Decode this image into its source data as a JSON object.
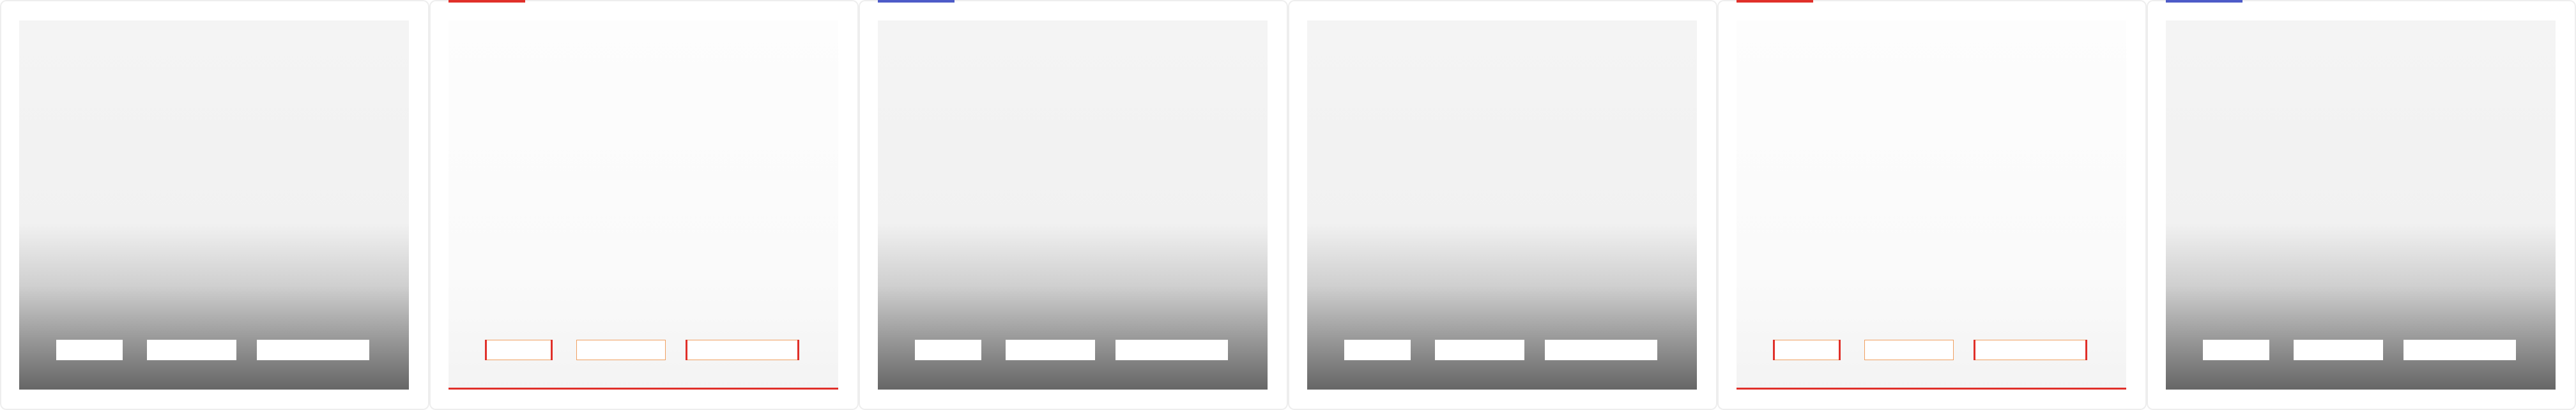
{
  "frames": [
    {
      "variant": "dark",
      "accent": "none",
      "buttons": [
        "",
        "",
        ""
      ]
    },
    {
      "variant": "light",
      "accent": "red",
      "buttons": [
        "",
        "",
        ""
      ]
    },
    {
      "variant": "dark",
      "accent": "blue",
      "buttons": [
        "",
        "",
        ""
      ]
    },
    {
      "variant": "dark",
      "accent": "none",
      "buttons": [
        "",
        "",
        ""
      ]
    },
    {
      "variant": "light",
      "accent": "red",
      "buttons": [
        "",
        "",
        ""
      ]
    },
    {
      "variant": "dark",
      "accent": "blue",
      "buttons": [
        "",
        "",
        ""
      ]
    }
  ],
  "colors": {
    "accent_red": "#e0302a",
    "accent_blue": "#4d5bc8",
    "button_border_orange": "#f0a060",
    "panel_dark_bottom": "#666666",
    "panel_light": "#fafafa"
  }
}
